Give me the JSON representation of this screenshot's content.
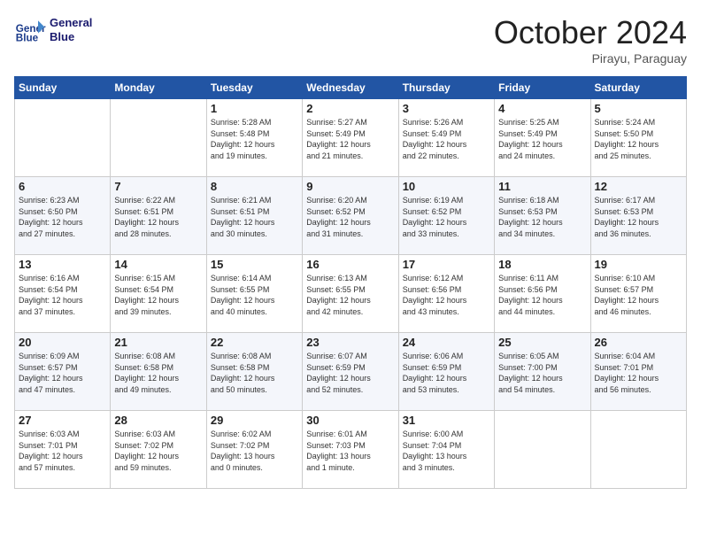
{
  "header": {
    "logo_line1": "General",
    "logo_line2": "Blue",
    "month_title": "October 2024",
    "location": "Pirayu, Paraguay"
  },
  "days_of_week": [
    "Sunday",
    "Monday",
    "Tuesday",
    "Wednesday",
    "Thursday",
    "Friday",
    "Saturday"
  ],
  "weeks": [
    [
      {
        "day": "",
        "info": ""
      },
      {
        "day": "",
        "info": ""
      },
      {
        "day": "1",
        "info": "Sunrise: 5:28 AM\nSunset: 5:48 PM\nDaylight: 12 hours\nand 19 minutes."
      },
      {
        "day": "2",
        "info": "Sunrise: 5:27 AM\nSunset: 5:49 PM\nDaylight: 12 hours\nand 21 minutes."
      },
      {
        "day": "3",
        "info": "Sunrise: 5:26 AM\nSunset: 5:49 PM\nDaylight: 12 hours\nand 22 minutes."
      },
      {
        "day": "4",
        "info": "Sunrise: 5:25 AM\nSunset: 5:49 PM\nDaylight: 12 hours\nand 24 minutes."
      },
      {
        "day": "5",
        "info": "Sunrise: 5:24 AM\nSunset: 5:50 PM\nDaylight: 12 hours\nand 25 minutes."
      }
    ],
    [
      {
        "day": "6",
        "info": "Sunrise: 6:23 AM\nSunset: 6:50 PM\nDaylight: 12 hours\nand 27 minutes."
      },
      {
        "day": "7",
        "info": "Sunrise: 6:22 AM\nSunset: 6:51 PM\nDaylight: 12 hours\nand 28 minutes."
      },
      {
        "day": "8",
        "info": "Sunrise: 6:21 AM\nSunset: 6:51 PM\nDaylight: 12 hours\nand 30 minutes."
      },
      {
        "day": "9",
        "info": "Sunrise: 6:20 AM\nSunset: 6:52 PM\nDaylight: 12 hours\nand 31 minutes."
      },
      {
        "day": "10",
        "info": "Sunrise: 6:19 AM\nSunset: 6:52 PM\nDaylight: 12 hours\nand 33 minutes."
      },
      {
        "day": "11",
        "info": "Sunrise: 6:18 AM\nSunset: 6:53 PM\nDaylight: 12 hours\nand 34 minutes."
      },
      {
        "day": "12",
        "info": "Sunrise: 6:17 AM\nSunset: 6:53 PM\nDaylight: 12 hours\nand 36 minutes."
      }
    ],
    [
      {
        "day": "13",
        "info": "Sunrise: 6:16 AM\nSunset: 6:54 PM\nDaylight: 12 hours\nand 37 minutes."
      },
      {
        "day": "14",
        "info": "Sunrise: 6:15 AM\nSunset: 6:54 PM\nDaylight: 12 hours\nand 39 minutes."
      },
      {
        "day": "15",
        "info": "Sunrise: 6:14 AM\nSunset: 6:55 PM\nDaylight: 12 hours\nand 40 minutes."
      },
      {
        "day": "16",
        "info": "Sunrise: 6:13 AM\nSunset: 6:55 PM\nDaylight: 12 hours\nand 42 minutes."
      },
      {
        "day": "17",
        "info": "Sunrise: 6:12 AM\nSunset: 6:56 PM\nDaylight: 12 hours\nand 43 minutes."
      },
      {
        "day": "18",
        "info": "Sunrise: 6:11 AM\nSunset: 6:56 PM\nDaylight: 12 hours\nand 44 minutes."
      },
      {
        "day": "19",
        "info": "Sunrise: 6:10 AM\nSunset: 6:57 PM\nDaylight: 12 hours\nand 46 minutes."
      }
    ],
    [
      {
        "day": "20",
        "info": "Sunrise: 6:09 AM\nSunset: 6:57 PM\nDaylight: 12 hours\nand 47 minutes."
      },
      {
        "day": "21",
        "info": "Sunrise: 6:08 AM\nSunset: 6:58 PM\nDaylight: 12 hours\nand 49 minutes."
      },
      {
        "day": "22",
        "info": "Sunrise: 6:08 AM\nSunset: 6:58 PM\nDaylight: 12 hours\nand 50 minutes."
      },
      {
        "day": "23",
        "info": "Sunrise: 6:07 AM\nSunset: 6:59 PM\nDaylight: 12 hours\nand 52 minutes."
      },
      {
        "day": "24",
        "info": "Sunrise: 6:06 AM\nSunset: 6:59 PM\nDaylight: 12 hours\nand 53 minutes."
      },
      {
        "day": "25",
        "info": "Sunrise: 6:05 AM\nSunset: 7:00 PM\nDaylight: 12 hours\nand 54 minutes."
      },
      {
        "day": "26",
        "info": "Sunrise: 6:04 AM\nSunset: 7:01 PM\nDaylight: 12 hours\nand 56 minutes."
      }
    ],
    [
      {
        "day": "27",
        "info": "Sunrise: 6:03 AM\nSunset: 7:01 PM\nDaylight: 12 hours\nand 57 minutes."
      },
      {
        "day": "28",
        "info": "Sunrise: 6:03 AM\nSunset: 7:02 PM\nDaylight: 12 hours\nand 59 minutes."
      },
      {
        "day": "29",
        "info": "Sunrise: 6:02 AM\nSunset: 7:02 PM\nDaylight: 13 hours\nand 0 minutes."
      },
      {
        "day": "30",
        "info": "Sunrise: 6:01 AM\nSunset: 7:03 PM\nDaylight: 13 hours\nand 1 minute."
      },
      {
        "day": "31",
        "info": "Sunrise: 6:00 AM\nSunset: 7:04 PM\nDaylight: 13 hours\nand 3 minutes."
      },
      {
        "day": "",
        "info": ""
      },
      {
        "day": "",
        "info": ""
      }
    ]
  ]
}
